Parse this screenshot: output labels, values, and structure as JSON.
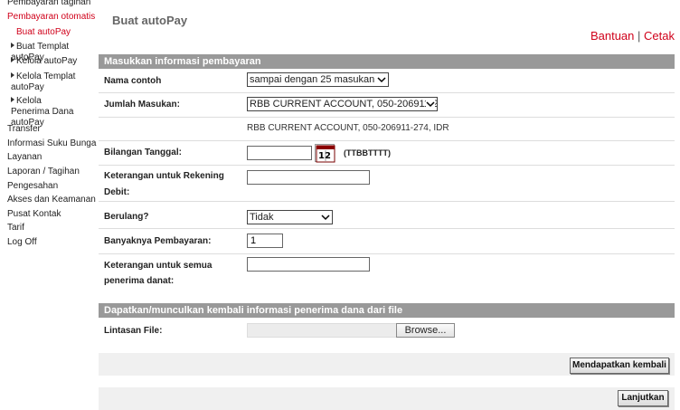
{
  "sidebar": {
    "items": [
      {
        "label": "Pembayaran tagihan"
      },
      {
        "label": "Pembayaran otomatis"
      },
      {
        "label": "Buat autoPay"
      },
      {
        "label": "Buat Templat autoPay"
      },
      {
        "label": "Kelola autoPay"
      },
      {
        "label": "Kelola Templat autoPay"
      },
      {
        "label": "Kelola Penerima Dana autoPay"
      },
      {
        "label": "Transfer"
      },
      {
        "label": "Informasi Suku Bunga"
      },
      {
        "label": "Layanan"
      },
      {
        "label": "Laporan / Tagihan"
      },
      {
        "label": "Pengesahan"
      },
      {
        "label": "Akses dan Keamanan"
      },
      {
        "label": "Pusat Kontak"
      },
      {
        "label": "Tarif"
      },
      {
        "label": "Log Off"
      }
    ]
  },
  "header": {
    "title": "Buat autoPay",
    "help": "Bantuan",
    "separator": "|",
    "print": "Cetak"
  },
  "payment_section": {
    "title": "Masukkan informasi pembayaran",
    "sample_name_label": "Nama contoh",
    "sample_name_value": "sampai dengan 25 masukan",
    "entries_label": "Jumlah Masukan:",
    "entries_value": "RBB CURRENT ACCOUNT, 050-206911-274, IDR",
    "account_info": "RBB CURRENT ACCOUNT, 050-206911-274, IDR",
    "date_label": "Bilangan Tanggal:",
    "date_value": "",
    "date_format": "(TTBBTTTT)",
    "debit_note_label_1": "Keterangan untuk Rekening",
    "debit_note_label_2": "Debit:",
    "debit_note_value": "",
    "recurring_label": "Berulang?",
    "recurring_value": "Tidak",
    "payment_count_label": "Banyaknya Pembayaran:",
    "payment_count_value": "1",
    "beneficiary_note_label_1": "Keterangan untuk semua",
    "beneficiary_note_label_2": "penerima danat:",
    "beneficiary_note_value": ""
  },
  "file_section": {
    "title": "Dapatkan/munculkan kembali informasi penerima dana dari file",
    "file_path_label": "Lintasan File:",
    "browse_label": "Browse...",
    "retrieve_button": "Mendapatkan kembali"
  },
  "footer": {
    "continue_button": "Lanjutkan"
  },
  "colors": {
    "accent_red": "#d0021b",
    "section_bar": "#999999"
  },
  "icons": {
    "calendar": "calendar-icon",
    "dropdown": "chevron-down-icon",
    "bullet": "triangle-right-icon"
  }
}
